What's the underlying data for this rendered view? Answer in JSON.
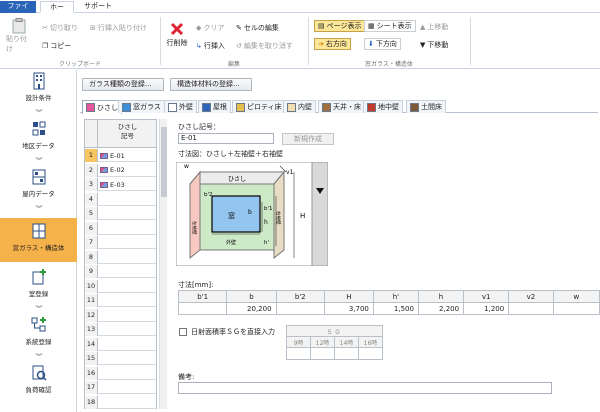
{
  "tabs": {
    "file": "ファイル",
    "home": "ホーム",
    "support": "サポート"
  },
  "ribbon": {
    "clipboard": {
      "paste": "貼り付け",
      "cut": "切り取り",
      "copy": "コピー",
      "insert_paste": "行挿入貼り付け",
      "group": "クリップボード"
    },
    "edit": {
      "delete_row": "行削除",
      "clear": "クリア",
      "edit_cell": "セルの編集",
      "insert_row": "行挿入",
      "cancel_edit": "編集を取り消す",
      "group": "編集"
    },
    "window": {
      "page_view": "ページ表示",
      "sheet_view": "シート表示",
      "move_up": "上移動",
      "right": "右方向",
      "down": "下方向",
      "move_down": "下移動",
      "group": "窓ガラス・構造体"
    }
  },
  "sidebar": {
    "items": [
      {
        "label": "設計条件",
        "icon": "building-icon"
      },
      {
        "label": "地区データ",
        "icon": "district-icon"
      },
      {
        "label": "屋内データ",
        "icon": "floor-icon"
      },
      {
        "label": "窓ガラス・構造体",
        "icon": "window-icon"
      },
      {
        "label": "室登録",
        "icon": "room-add-icon"
      },
      {
        "label": "系統登録",
        "icon": "system-icon"
      },
      {
        "label": "負荷確認",
        "icon": "load-check-icon"
      }
    ],
    "active_index": 3
  },
  "content": {
    "glass_register": "ガラス種類の登録...",
    "material_register": "構造体材料の登録...",
    "subtabs": [
      {
        "label": "ひさし",
        "color": "#e5579a"
      },
      {
        "label": "窓ガラス",
        "color": "#3f8fd8"
      },
      {
        "label": "外壁",
        "color": "#7fa0c8"
      },
      {
        "label": "屋根",
        "color": "#2f64b8"
      },
      {
        "label": "ピロティ床",
        "color": "#e6c04f"
      },
      {
        "label": "内壁",
        "color": "#e8c880"
      },
      {
        "label": "天井・床",
        "color": "#a07040"
      },
      {
        "label": "地中壁",
        "color": "#c0392b"
      },
      {
        "label": "土間床",
        "color": "#7a5a3a"
      }
    ],
    "grid": {
      "header": "ひさし\n記号",
      "rows": [
        "E-01",
        "E-02",
        "E-03",
        "",
        "",
        "",
        "",
        "",
        "",
        "",
        "",
        "",
        "",
        "",
        "",
        "",
        "",
        "",
        "",
        ""
      ],
      "numbers": [
        "1",
        "2",
        "3",
        "4",
        "5",
        "6",
        "7",
        "8",
        "9",
        "10",
        "11",
        "12",
        "13",
        "14",
        "15",
        "16",
        "17",
        "18"
      ]
    },
    "detail": {
      "code_label": "ひさし記号：",
      "code_value": "E-01",
      "new_button": "新規作成",
      "diagram_label": "寸法図：ひさし＋左袖壁＋右袖壁",
      "dims_label": "寸法[mm]:",
      "dim_headers": [
        "b'1",
        "b",
        "b'2",
        "H",
        "h'",
        "h",
        "v1",
        "v2",
        "w"
      ],
      "dim_values": [
        "",
        "20,200",
        "",
        "3,700",
        "1,500",
        "2,200",
        "1,200",
        "",
        ""
      ],
      "sun_checkbox": "日射面積率ＳＧを直接入力",
      "sg_title": "ＳＧ",
      "sg_hours": [
        "9時",
        "12時",
        "14時",
        "16時"
      ],
      "remarks_label": "備考:"
    },
    "diagram_text": {
      "v1": "v1",
      "w": "w",
      "hisashi": "ひさし",
      "left_wall": "左袖壁",
      "right_wall": "右袖壁",
      "window": "窓",
      "outer_wall": "外壁",
      "b": "b",
      "b2": "b'2",
      "b1": "b'1",
      "h": "h",
      "h2": "h'",
      "H": "H"
    }
  }
}
